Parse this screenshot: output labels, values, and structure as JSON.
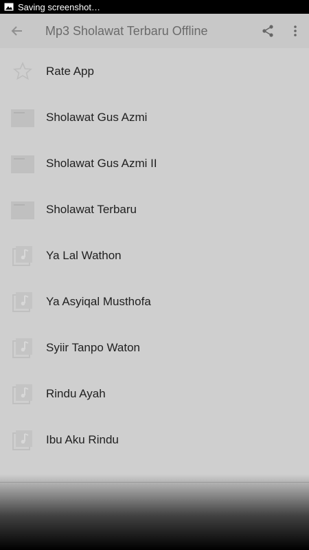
{
  "status": {
    "text": "Saving screenshot…"
  },
  "app_bar": {
    "title": "Mp3 Sholawat Terbaru Offline",
    "back_icon": "back-arrow-icon",
    "share_icon": "share-icon",
    "more_icon": "more-vert-icon"
  },
  "items": [
    {
      "label": "Rate App",
      "icon": "star-icon"
    },
    {
      "label": "Sholawat Gus Azmi",
      "icon": "folder-icon"
    },
    {
      "label": "Sholawat Gus Azmi II",
      "icon": "folder-icon"
    },
    {
      "label": "Sholawat Terbaru",
      "icon": "folder-icon"
    },
    {
      "label": "Ya Lal Wathon",
      "icon": "music-library-icon"
    },
    {
      "label": "Ya Asyiqal Musthofa",
      "icon": "music-library-icon"
    },
    {
      "label": "Syiir Tanpo Waton",
      "icon": "music-library-icon"
    },
    {
      "label": "Rindu Ayah",
      "icon": "music-library-icon"
    },
    {
      "label": "Ibu Aku Rindu",
      "icon": "music-library-icon"
    }
  ]
}
